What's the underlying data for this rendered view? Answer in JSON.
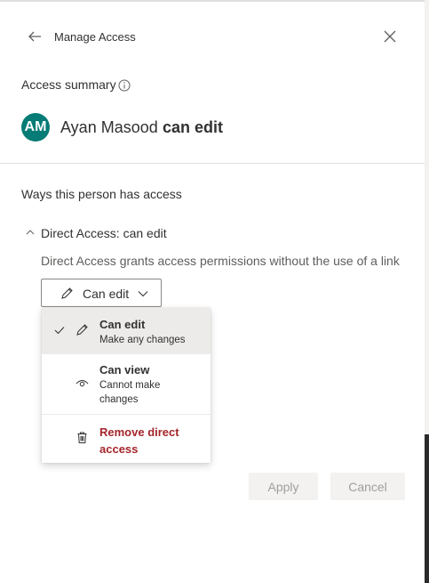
{
  "header": {
    "title": "Manage Access",
    "back_icon": "arrow-left-icon",
    "close_icon": "close-icon"
  },
  "summary": {
    "label": "Access summary",
    "info_icon": "info-icon",
    "person": {
      "initials": "AM",
      "avatar_color": "#077b76",
      "name": "Ayan Masood",
      "permission": "can edit"
    }
  },
  "ways": {
    "label": "Ways this person has access",
    "direct": {
      "title": "Direct Access: can edit",
      "description": "Direct Access grants access permissions without the use of a link",
      "button_label": "Can edit"
    }
  },
  "menu": {
    "items": [
      {
        "title": "Can edit",
        "subtitle": "Make any changes",
        "icon": "pencil-icon",
        "selected": true
      },
      {
        "title": "Can view",
        "subtitle": "Cannot make changes",
        "icon": "eye-icon",
        "selected": false
      },
      {
        "title": "Remove direct access",
        "icon": "trash-icon",
        "danger": true,
        "danger_color": "#a4262c"
      }
    ]
  },
  "footer": {
    "apply_label": "Apply",
    "cancel_label": "Cancel",
    "apply_enabled": false
  }
}
